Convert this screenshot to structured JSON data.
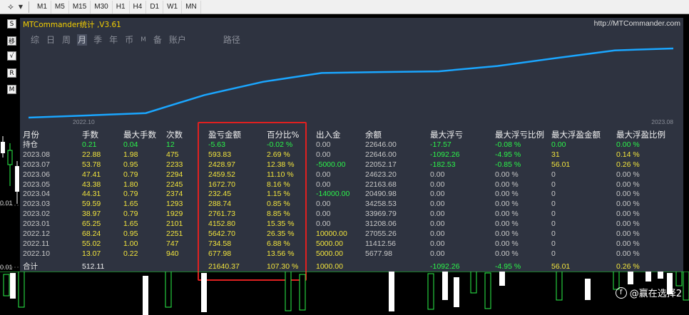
{
  "toolbar": {
    "timeframes": [
      "M1",
      "M5",
      "M15",
      "M30",
      "H1",
      "H4",
      "D1",
      "W1",
      "MN"
    ]
  },
  "side": {
    "buttons": [
      "S",
      "移",
      "√",
      "R",
      "M"
    ],
    "price_labels": [
      "0.01",
      "0.01"
    ]
  },
  "panel": {
    "title": "MTCommander统计 ,V3.61",
    "url": "http://MTCommander.com",
    "tabs": [
      "综",
      "日",
      "周",
      "月",
      "季",
      "年",
      "币",
      "M",
      "备",
      "账户",
      "路径"
    ],
    "active_tab": "月"
  },
  "chart_data": {
    "type": "line",
    "x_start_label": "2022.10",
    "x_end_label": "2023.08",
    "line_color": "#1aa6ff",
    "x": [
      "2022.10",
      "2022.11",
      "2022.12",
      "2023.01",
      "2023.02",
      "2023.03",
      "2023.04",
      "2023.05",
      "2023.06",
      "2023.07",
      "2023.08"
    ],
    "values": [
      5677.98,
      11412.56,
      27055.26,
      31208.06,
      33969.79,
      34258.53,
      20490.98,
      22163.68,
      24623.2,
      22052.17,
      22646.0
    ]
  },
  "table": {
    "headers": [
      "月份",
      "手数",
      "最大手数",
      "次数",
      "盈亏金额",
      "百分比%",
      "出入金",
      "余额",
      "最大浮亏",
      "最大浮亏比例",
      "最大浮盈金额",
      "最大浮盈比例"
    ],
    "position_row": {
      "label": "持仓",
      "cells": [
        "0.21",
        "0.04",
        "12",
        "-5.63",
        "-0.02 %",
        "0.00",
        "22646.00",
        "-17.57",
        "-0.08 %",
        "0.00",
        "0.00 %"
      ]
    },
    "rows": [
      [
        "2023.08",
        "22.88",
        "1.98",
        "475",
        "593.83",
        "2.69 %",
        "0.00",
        "22646.00",
        "-1092.26",
        "-4.95 %",
        "31",
        "0.14 %"
      ],
      [
        "2023.07",
        "53.78",
        "0.95",
        "2233",
        "2428.97",
        "12.38 %",
        "-5000.00",
        "22052.17",
        "-182.53",
        "-0.85 %",
        "56.01",
        "0.26 %"
      ],
      [
        "2023.06",
        "47.41",
        "0.79",
        "2294",
        "2459.52",
        "11.10 %",
        "0.00",
        "24623.20",
        "0.00",
        "0.00 %",
        "0",
        "0.00 %"
      ],
      [
        "2023.05",
        "43.38",
        "1.80",
        "2245",
        "1672.70",
        "8.16 %",
        "0.00",
        "22163.68",
        "0.00",
        "0.00 %",
        "0",
        "0.00 %"
      ],
      [
        "2023.04",
        "44.31",
        "0.79",
        "2374",
        "232.45",
        "1.15 %",
        "-14000.00",
        "20490.98",
        "0.00",
        "0.00 %",
        "0",
        "0.00 %"
      ],
      [
        "2023.03",
        "59.59",
        "1.65",
        "1293",
        "288.74",
        "0.85 %",
        "0.00",
        "34258.53",
        "0.00",
        "0.00 %",
        "0",
        "0.00 %"
      ],
      [
        "2023.02",
        "38.97",
        "0.79",
        "1929",
        "2761.73",
        "8.85 %",
        "0.00",
        "33969.79",
        "0.00",
        "0.00 %",
        "0",
        "0.00 %"
      ],
      [
        "2023.01",
        "65.25",
        "1.65",
        "2101",
        "4152.80",
        "15.35 %",
        "0.00",
        "31208.06",
        "0.00",
        "0.00 %",
        "0",
        "0.00 %"
      ],
      [
        "2022.12",
        "68.24",
        "0.95",
        "2251",
        "5642.70",
        "26.35 %",
        "10000.00",
        "27055.26",
        "0.00",
        "0.00 %",
        "0",
        "0.00 %"
      ],
      [
        "2022.11",
        "55.02",
        "1.00",
        "747",
        "734.58",
        "6.88 %",
        "5000.00",
        "11412.56",
        "0.00",
        "0.00 %",
        "0",
        "0.00 %"
      ],
      [
        "2022.10",
        "13.07",
        "0.22",
        "940",
        "677.98",
        "13.56 %",
        "5000.00",
        "5677.98",
        "0.00",
        "0.00 %",
        "0",
        "0.00 %"
      ]
    ],
    "total_row": {
      "label": "合计",
      "lots": "512.11",
      "profit": "21640.37",
      "pct": "107.30 %",
      "flow": "1000.00",
      "max_loss": "-1092.26",
      "max_loss_pct": "-4.95 %",
      "max_gain": "56.01",
      "max_gain_pct": "0.26 %"
    }
  },
  "watermark": {
    "text": "@赢在选择2",
    "logo": "f"
  }
}
